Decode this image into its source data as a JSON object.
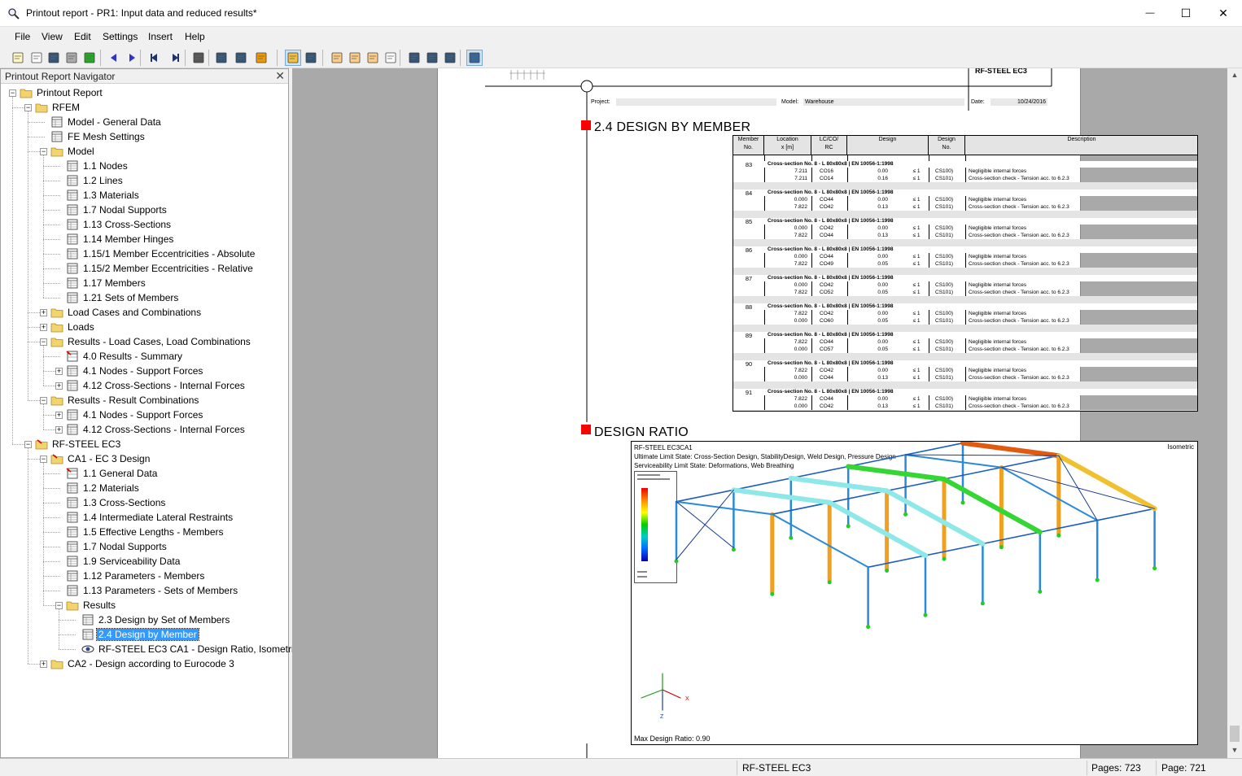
{
  "window": {
    "title": "Printout report - PR1: Input data and reduced results*",
    "minimize": "—",
    "maximize": "☐",
    "close": "✕"
  },
  "menu": [
    "File",
    "View",
    "Edit",
    "Settings",
    "Insert",
    "Help"
  ],
  "toolbar_icons": [
    "new-report-icon",
    "open-icon",
    "save-icon",
    "print-icon",
    "refresh-icon",
    "prev-icon",
    "next-icon",
    "first-page-icon",
    "last-page-icon",
    "page-setup-icon",
    "find-icon",
    "find-next-icon",
    "settings-icon",
    "select-icon",
    "zoom-icon",
    "header-icon",
    "doc-icon",
    "insert-icon",
    "page-icon",
    "graphics-icon",
    "graphics2-icon",
    "graphics3-icon",
    "dynamic-icon"
  ],
  "navigator": {
    "title": "Printout Report Navigator",
    "close": "✕",
    "items": [
      {
        "label": "Printout Report",
        "level": 0,
        "icon": "folder",
        "exp": "-"
      },
      {
        "label": "RFEM",
        "level": 1,
        "icon": "folder",
        "exp": "-"
      },
      {
        "label": "Model - General Data",
        "level": 2,
        "icon": "table",
        "exp": ""
      },
      {
        "label": "FE Mesh Settings",
        "level": 2,
        "icon": "table",
        "exp": ""
      },
      {
        "label": "Model",
        "level": 2,
        "icon": "folder",
        "exp": "-"
      },
      {
        "label": "1.1 Nodes",
        "level": 3,
        "icon": "table",
        "exp": ""
      },
      {
        "label": "1.2 Lines",
        "level": 3,
        "icon": "table",
        "exp": ""
      },
      {
        "label": "1.3 Materials",
        "level": 3,
        "icon": "table",
        "exp": ""
      },
      {
        "label": "1.7 Nodal Supports",
        "level": 3,
        "icon": "table",
        "exp": ""
      },
      {
        "label": "1.13 Cross-Sections",
        "level": 3,
        "icon": "table",
        "exp": ""
      },
      {
        "label": "1.14 Member Hinges",
        "level": 3,
        "icon": "table",
        "exp": ""
      },
      {
        "label": "1.15/1 Member Eccentricities - Absolute",
        "level": 3,
        "icon": "table",
        "exp": ""
      },
      {
        "label": "1.15/2 Member Eccentricities - Relative",
        "level": 3,
        "icon": "table",
        "exp": ""
      },
      {
        "label": "1.17 Members",
        "level": 3,
        "icon": "table",
        "exp": ""
      },
      {
        "label": "1.21 Sets of Members",
        "level": 3,
        "icon": "table",
        "exp": ""
      },
      {
        "label": "Load Cases and Combinations",
        "level": 2,
        "icon": "folder",
        "exp": "+"
      },
      {
        "label": "Loads",
        "level": 2,
        "icon": "folder",
        "exp": "+"
      },
      {
        "label": "Results - Load Cases, Load Combinations",
        "level": 2,
        "icon": "folder",
        "exp": "-"
      },
      {
        "label": "4.0 Results - Summary",
        "level": 3,
        "icon": "result",
        "exp": ""
      },
      {
        "label": "4.1 Nodes - Support Forces",
        "level": 3,
        "icon": "table",
        "exp": "+"
      },
      {
        "label": "4.12 Cross-Sections - Internal Forces",
        "level": 3,
        "icon": "table",
        "exp": "+"
      },
      {
        "label": "Results - Result Combinations",
        "level": 2,
        "icon": "folder",
        "exp": "-"
      },
      {
        "label": "4.1 Nodes - Support Forces",
        "level": 3,
        "icon": "table",
        "exp": "+"
      },
      {
        "label": "4.12 Cross-Sections - Internal Forces",
        "level": 3,
        "icon": "table",
        "exp": "+"
      },
      {
        "label": "RF-STEEL EC3",
        "level": 1,
        "icon": "module",
        "exp": "-"
      },
      {
        "label": "CA1 - EC 3 Design",
        "level": 2,
        "icon": "module",
        "exp": "-"
      },
      {
        "label": "1.1 General Data",
        "level": 3,
        "icon": "result",
        "exp": ""
      },
      {
        "label": "1.2 Materials",
        "level": 3,
        "icon": "table",
        "exp": ""
      },
      {
        "label": "1.3 Cross-Sections",
        "level": 3,
        "icon": "table",
        "exp": ""
      },
      {
        "label": "1.4 Intermediate Lateral Restraints",
        "level": 3,
        "icon": "table",
        "exp": ""
      },
      {
        "label": "1.5 Effective Lengths - Members",
        "level": 3,
        "icon": "table",
        "exp": ""
      },
      {
        "label": "1.7 Nodal Supports",
        "level": 3,
        "icon": "table",
        "exp": ""
      },
      {
        "label": "1.9 Serviceability Data",
        "level": 3,
        "icon": "table",
        "exp": ""
      },
      {
        "label": "1.12 Parameters - Members",
        "level": 3,
        "icon": "table",
        "exp": ""
      },
      {
        "label": "1.13 Parameters - Sets of Members",
        "level": 3,
        "icon": "table",
        "exp": ""
      },
      {
        "label": "Results",
        "level": 3,
        "icon": "folder",
        "exp": "-"
      },
      {
        "label": "2.3 Design by Set of Members",
        "level": 4,
        "icon": "table",
        "exp": ""
      },
      {
        "label": "2.4 Design by Member",
        "level": 4,
        "icon": "table",
        "exp": "",
        "selected": true
      },
      {
        "label": "RF-STEEL EC3 CA1 - Design Ratio, Isometric",
        "level": 4,
        "icon": "eye",
        "exp": ""
      },
      {
        "label": "CA2 - Design according to Eurocode 3",
        "level": 2,
        "icon": "folder",
        "exp": "+"
      }
    ]
  },
  "page": {
    "header_module": "RF-STEEL EC3",
    "project_label": "Project:",
    "model_label": "Model:",
    "model_value": "Warehouse",
    "date_label": "Date:",
    "date_value": "10/24/2016",
    "section1_title": "2.4 DESIGN BY MEMBER",
    "section2_title": "DESIGN RATIO"
  },
  "table": {
    "headers": [
      {
        "l1": "Member",
        "l2": "No."
      },
      {
        "l1": "Location",
        "l2": "x [m]"
      },
      {
        "l1": "LC/CO/",
        "l2": "RC"
      },
      {
        "l1": "Design",
        "l2": ""
      },
      {
        "l1": "Design",
        "l2": "No."
      },
      {
        "l1": "Description",
        "l2": ""
      }
    ],
    "members": [
      {
        "no": "83",
        "xs": "Cross-section No. 8 - L 80x80x8 | EN 10056-1:1998",
        "rows": [
          [
            "7.211",
            "CO16",
            "0.00",
            "≤ 1",
            "CS100)",
            "Negligible internal forces"
          ],
          [
            "7.211",
            "CO14",
            "0.16",
            "≤ 1",
            "CS101)",
            "Cross-section check - Tension acc. to 6.2.3"
          ]
        ]
      },
      {
        "no": "84",
        "xs": "Cross-section No. 8 - L 80x80x8 | EN 10056-1:1998",
        "rows": [
          [
            "0.000",
            "CO44",
            "0.00",
            "≤ 1",
            "CS100)",
            "Negligible internal forces"
          ],
          [
            "7.822",
            "CO42",
            "0.13",
            "≤ 1",
            "CS101)",
            "Cross-section check - Tension acc. to 6.2.3"
          ]
        ]
      },
      {
        "no": "85",
        "xs": "Cross-section No. 8 - L 80x80x8 | EN 10056-1:1998",
        "rows": [
          [
            "0.000",
            "CO42",
            "0.00",
            "≤ 1",
            "CS100)",
            "Negligible internal forces"
          ],
          [
            "7.822",
            "CO44",
            "0.13",
            "≤ 1",
            "CS101)",
            "Cross-section check - Tension acc. to 6.2.3"
          ]
        ]
      },
      {
        "no": "86",
        "xs": "Cross-section No. 8 - L 80x80x8 | EN 10056-1:1998",
        "rows": [
          [
            "0.000",
            "CO44",
            "0.00",
            "≤ 1",
            "CS100)",
            "Negligible internal forces"
          ],
          [
            "7.822",
            "CO49",
            "0.05",
            "≤ 1",
            "CS101)",
            "Cross-section check - Tension acc. to 6.2.3"
          ]
        ]
      },
      {
        "no": "87",
        "xs": "Cross-section No. 8 - L 80x80x8 | EN 10056-1:1998",
        "rows": [
          [
            "0.000",
            "CO42",
            "0.00",
            "≤ 1",
            "CS100)",
            "Negligible internal forces"
          ],
          [
            "7.822",
            "CO52",
            "0.05",
            "≤ 1",
            "CS101)",
            "Cross-section check - Tension acc. to 6.2.3"
          ]
        ]
      },
      {
        "no": "88",
        "xs": "Cross-section No. 8 - L 80x80x8 | EN 10056-1:1998",
        "rows": [
          [
            "7.822",
            "CO42",
            "0.00",
            "≤ 1",
            "CS100)",
            "Negligible internal forces"
          ],
          [
            "0.000",
            "CO60",
            "0.05",
            "≤ 1",
            "CS101)",
            "Cross-section check - Tension acc. to 6.2.3"
          ]
        ]
      },
      {
        "no": "89",
        "xs": "Cross-section No. 8 - L 80x80x8 | EN 10056-1:1998",
        "rows": [
          [
            "7.822",
            "CO44",
            "0.00",
            "≤ 1",
            "CS100)",
            "Negligible internal forces"
          ],
          [
            "0.000",
            "CO57",
            "0.05",
            "≤ 1",
            "CS101)",
            "Cross-section check - Tension acc. to 6.2.3"
          ]
        ]
      },
      {
        "no": "90",
        "xs": "Cross-section No. 8 - L 80x80x8 | EN 10056-1:1998",
        "rows": [
          [
            "7.822",
            "CO42",
            "0.00",
            "≤ 1",
            "CS100)",
            "Negligible internal forces"
          ],
          [
            "0.000",
            "CO44",
            "0.13",
            "≤ 1",
            "CS101)",
            "Cross-section check - Tension acc. to 6.2.3"
          ]
        ]
      },
      {
        "no": "91",
        "xs": "Cross-section No. 8 - L 80x80x8 | EN 10056-1:1998",
        "rows": [
          [
            "7.822",
            "CO44",
            "0.00",
            "≤ 1",
            "CS100)",
            "Negligible internal forces"
          ],
          [
            "0.000",
            "CO42",
            "0.13",
            "≤ 1",
            "CS101)",
            "Cross-section check - Tension acc. to 6.2.3"
          ]
        ]
      }
    ]
  },
  "figure": {
    "line1": "RF-STEEL EC3CA1",
    "line2": "Ultimate Limit State: Cross-Section Design, StabilityDesign, Weld Design, Pressure Design",
    "line3": "Serviceability Limit State: Deformations, Web Breathing",
    "view": "Isometric",
    "footer": "Max Design Ratio: 0.90",
    "axis_x": "X",
    "axis_z": "Z"
  },
  "status": {
    "module": "RF-STEEL EC3",
    "pages": "Pages: 723",
    "page": "Page: 721"
  }
}
